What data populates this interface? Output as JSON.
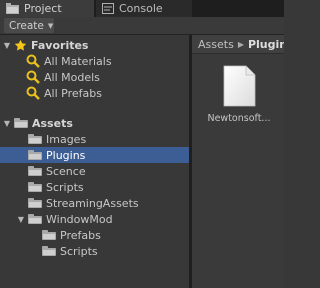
{
  "tabs": [
    {
      "label": "Project",
      "icon": "project-folder-icon",
      "active": true
    },
    {
      "label": "Console",
      "icon": "console-icon",
      "active": false
    }
  ],
  "toolbar": {
    "create_label": "Create"
  },
  "tree": {
    "favorites": {
      "label": "Favorites",
      "items": [
        "All Materials",
        "All Models",
        "All Prefabs"
      ]
    },
    "assets": {
      "label": "Assets",
      "items": {
        "images": "Images",
        "plugins": "Plugins",
        "scence": "Scence",
        "scripts": "Scripts",
        "streaming": "StreamingAssets",
        "windowmod": "WindowMod",
        "prefabs": "Prefabs",
        "wm_scripts": "Scripts"
      }
    },
    "selected": "Plugins"
  },
  "breadcrumb": {
    "root": "Assets",
    "current": "Plugins"
  },
  "files": [
    {
      "name": "Newtonsoft...",
      "icon": "document-icon"
    }
  ],
  "colors": {
    "selection": "#3d5e94",
    "favorite_star": "#f5c518",
    "search_icon": "#e8c21a"
  }
}
